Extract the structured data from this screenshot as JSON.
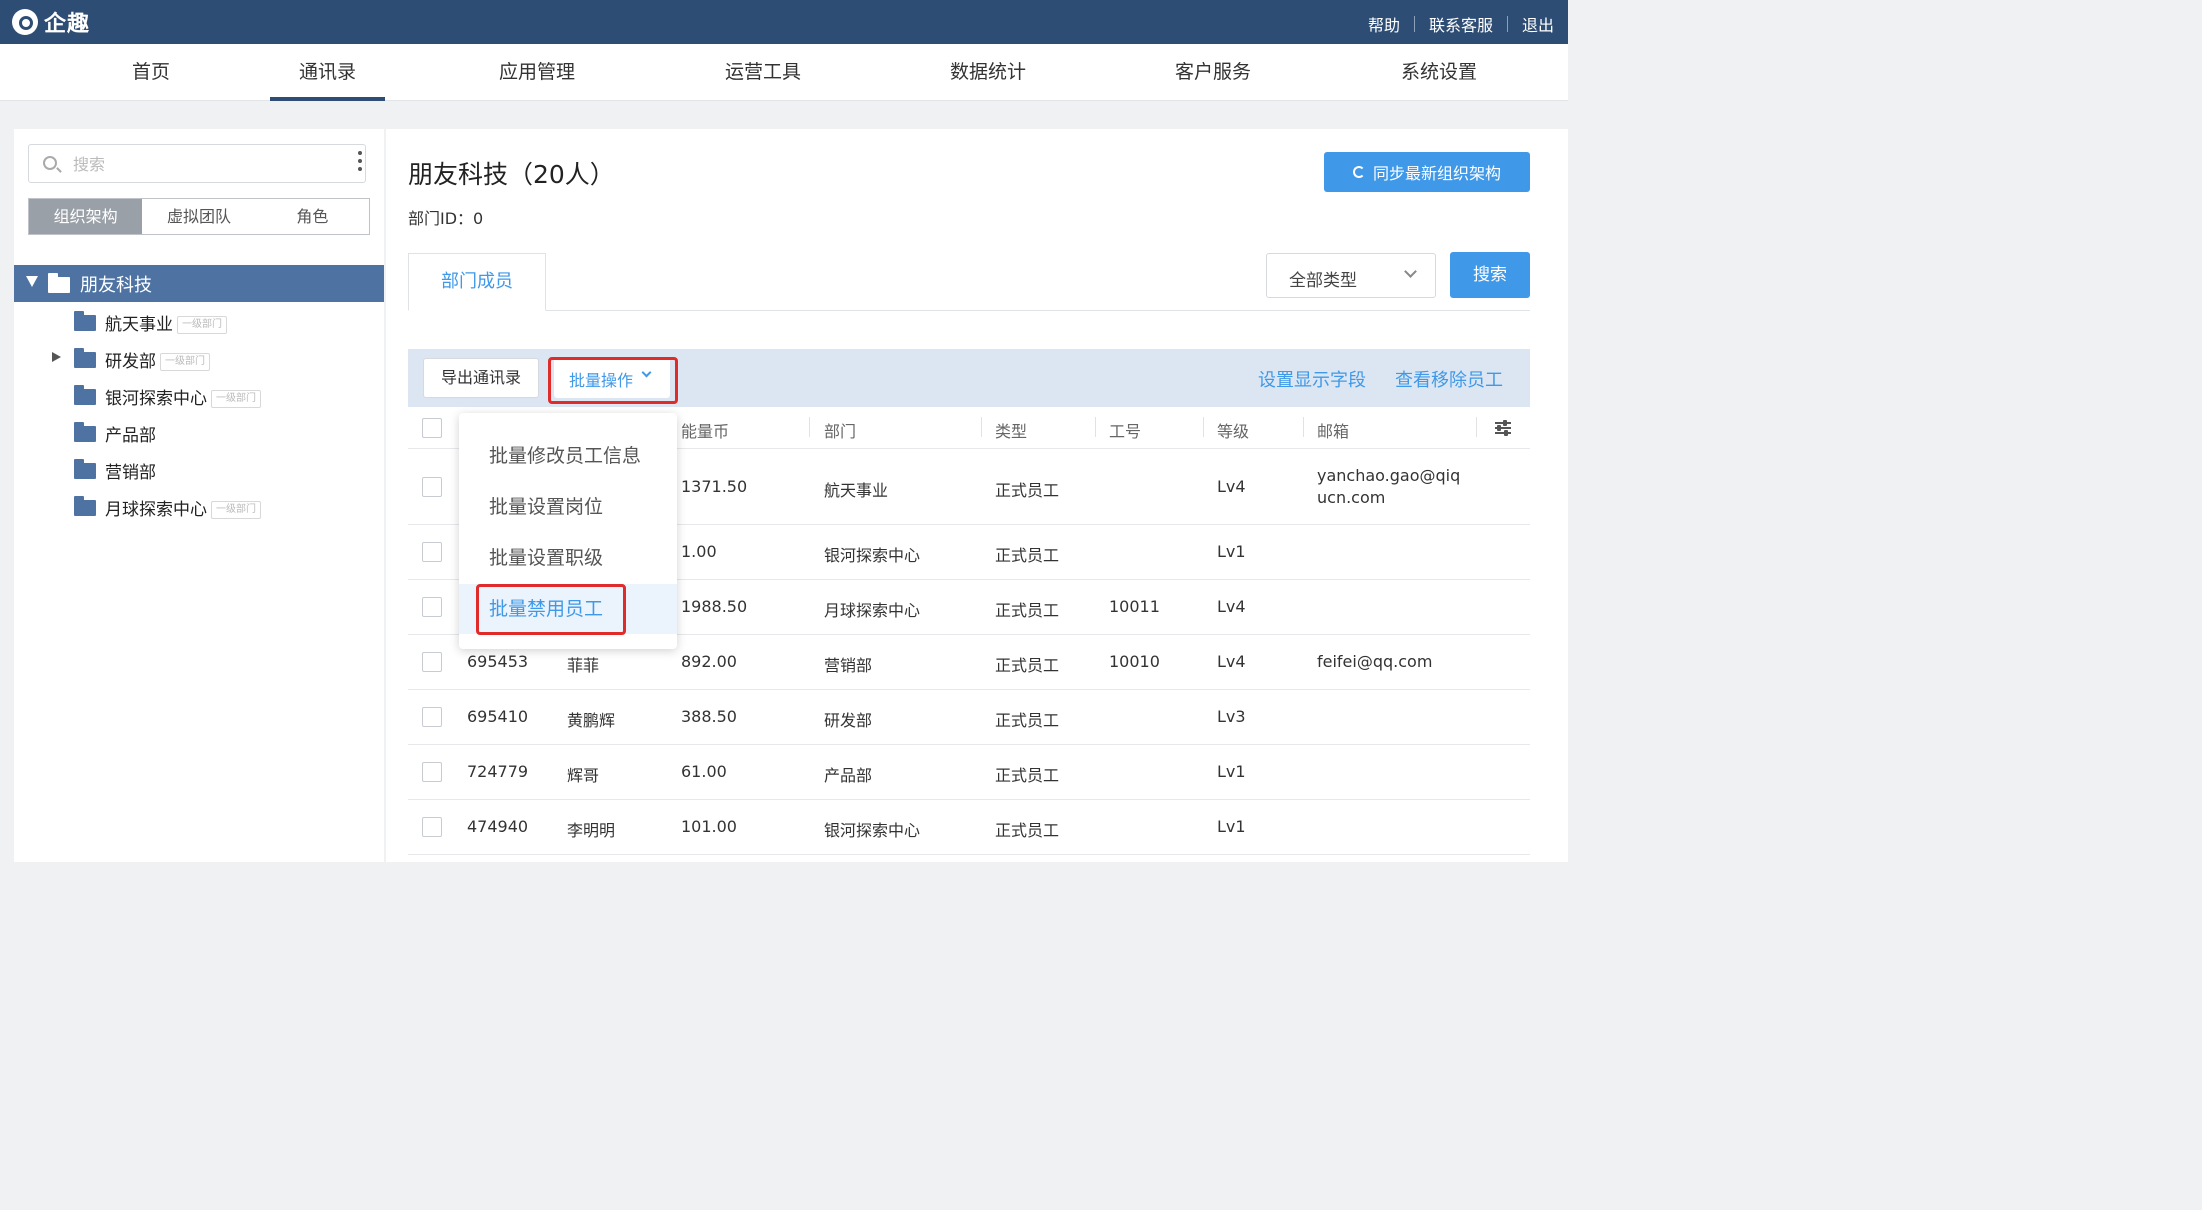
{
  "app": {
    "logo_text": "企趣"
  },
  "top_links": [
    "帮助",
    "联系客服",
    "退出"
  ],
  "nav": [
    "首页",
    "通讯录",
    "应用管理",
    "运营工具",
    "数据统计",
    "客户服务",
    "系统设置"
  ],
  "sidebar": {
    "search_placeholder": "搜索",
    "tabs": [
      "组织架构",
      "虚拟团队",
      "角色"
    ],
    "root": "朋友科技",
    "badge": "一级部门",
    "items": [
      "航天事业",
      "研发部",
      "银河探索中心",
      "产品部",
      "营销部",
      "月球探索中心"
    ]
  },
  "main": {
    "title": "朋友科技（20人）",
    "dept_id": "部门ID：0",
    "sync_button": "同步最新组织架构",
    "tab": "部门成员",
    "type_select": "全部类型",
    "search_button": "搜索",
    "export_button": "导出通讯录",
    "batch_button": "批量操作",
    "link_fields": "设置显示字段",
    "link_removed": "查看移除员工"
  },
  "dropdown": [
    "批量修改员工信息",
    "批量设置岗位",
    "批量设置职级",
    "批量禁用员工"
  ],
  "table": {
    "headers": [
      "能量币",
      "部门",
      "类型",
      "工号",
      "等级",
      "邮箱"
    ],
    "rows": [
      {
        "id": "",
        "name": "",
        "coins": "1371.50",
        "dept": "航天事业",
        "type": "正式员工",
        "no": "",
        "level": "Lv4",
        "email": "yanchao.gao@qiqucn.com"
      },
      {
        "id": "",
        "name": "",
        "coins": "1.00",
        "dept": "银河探索中心",
        "type": "正式员工",
        "no": "",
        "level": "Lv1",
        "email": ""
      },
      {
        "id": "",
        "name": "",
        "coins": "1988.50",
        "dept": "月球探索中心",
        "type": "正式员工",
        "no": "10011",
        "level": "Lv4",
        "email": ""
      },
      {
        "id": "695453",
        "name": "菲菲",
        "coins": "892.00",
        "dept": "营销部",
        "type": "正式员工",
        "no": "10010",
        "level": "Lv4",
        "email": "feifei@qq.com"
      },
      {
        "id": "695410",
        "name": "黄鹏辉",
        "coins": "388.50",
        "dept": "研发部",
        "type": "正式员工",
        "no": "",
        "level": "Lv3",
        "email": ""
      },
      {
        "id": "724779",
        "name": "辉哥",
        "coins": "61.00",
        "dept": "产品部",
        "type": "正式员工",
        "no": "",
        "level": "Lv1",
        "email": ""
      },
      {
        "id": "474940",
        "name": "李明明",
        "coins": "101.00",
        "dept": "银河探索中心",
        "type": "正式员工",
        "no": "",
        "level": "Lv1",
        "email": ""
      }
    ]
  },
  "colors": {
    "topbar": "#2e4d74",
    "accent": "#3f99e8",
    "highlight": "#e02b2b"
  }
}
